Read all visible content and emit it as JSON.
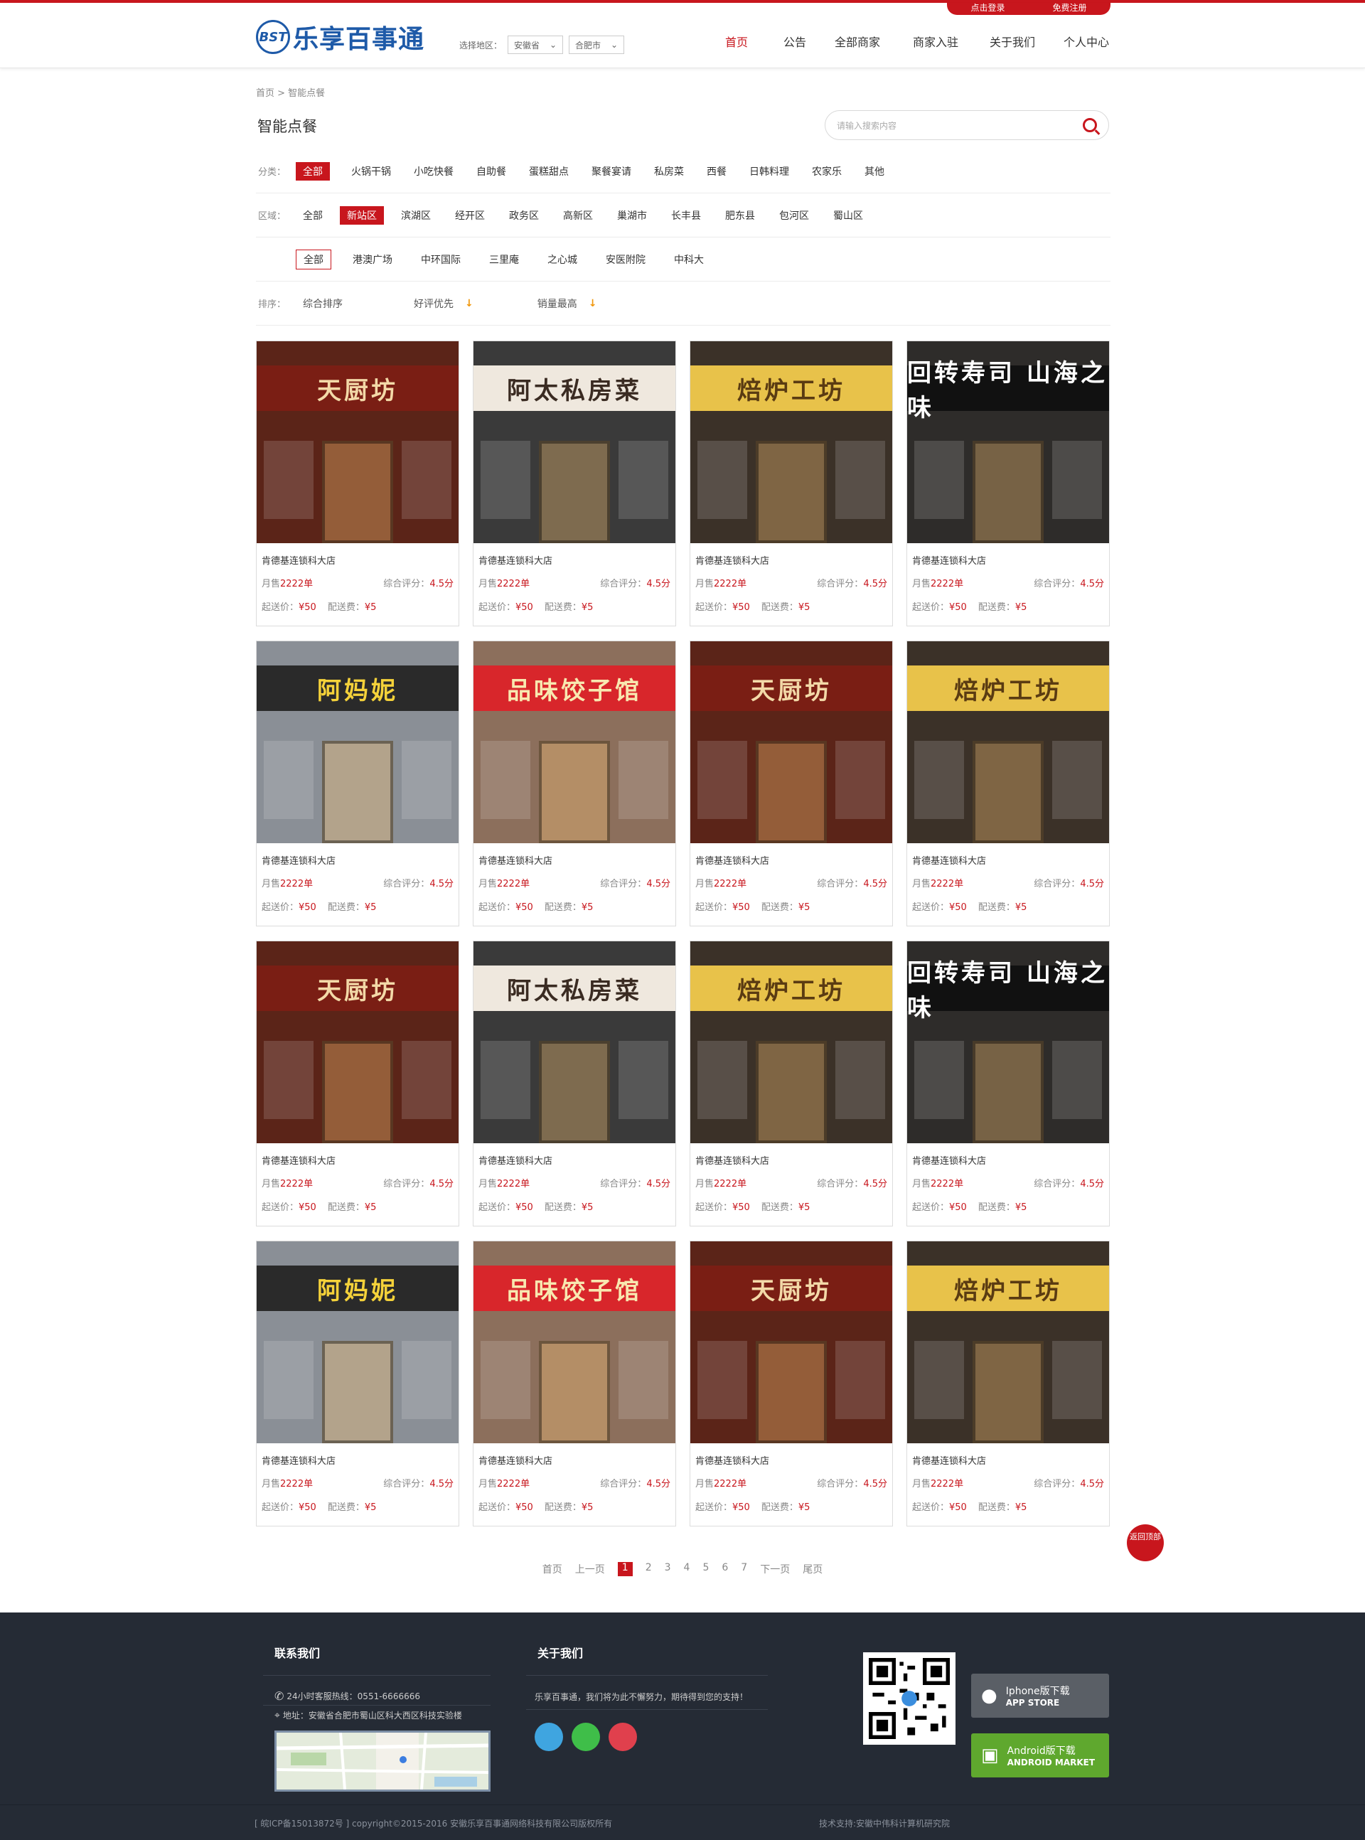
{
  "top_links": {
    "login": "点击登录",
    "register": "免费注册"
  },
  "logo": {
    "badge": "BST",
    "name": "乐享百事通"
  },
  "region": {
    "label": "选择地区：",
    "province": "安徽省",
    "city": "合肥市"
  },
  "nav": [
    "首页",
    "公告",
    "全部商家",
    "商家入驻",
    "关于我们",
    "个人中心"
  ],
  "breadcrumb": "首页 > 智能点餐",
  "page_title": "智能点餐",
  "search": {
    "placeholder": "请输入搜索内容"
  },
  "filters": {
    "category_label": "分类：",
    "categories": [
      "全部",
      "火锅干锅",
      "小吃快餐",
      "自助餐",
      "蛋糕甜点",
      "聚餐宴请",
      "私房菜",
      "西餐",
      "日韩料理",
      "农家乐",
      "其他"
    ],
    "area_label": "区域：",
    "areas": [
      "全部",
      "新站区",
      "滨湖区",
      "经开区",
      "政务区",
      "高新区",
      "巢湖市",
      "长丰县",
      "肥东县",
      "包河区",
      "蜀山区"
    ],
    "subareas": [
      "全部",
      "港澳广场",
      "中环国际",
      "三里庵",
      "之心城",
      "安医附院",
      "中科大"
    ],
    "sort_label": "排序：",
    "sorts": [
      "综合排序",
      "好评优先",
      "销量最高"
    ]
  },
  "cards": [
    {
      "name": "肯德基连锁科大店",
      "sales": "2222单",
      "score": "4.5分",
      "min": "¥50",
      "fee": "¥5",
      "sign": "天厨坊",
      "theme": "red"
    },
    {
      "name": "肯德基连锁科大店",
      "sales": "2222单",
      "score": "4.5分",
      "min": "¥50",
      "fee": "¥5",
      "sign": "阿太私房菜",
      "theme": "dark"
    },
    {
      "name": "肯德基连锁科大店",
      "sales": "2222单",
      "score": "4.5分",
      "min": "¥50",
      "fee": "¥5",
      "sign": "焙炉工坊",
      "theme": "gold"
    },
    {
      "name": "肯德基连锁科大店",
      "sales": "2222单",
      "score": "4.5分",
      "min": "¥50",
      "fee": "¥5",
      "sign": "回转寿司 山海之味",
      "theme": "black"
    },
    {
      "name": "肯德基连锁科大店",
      "sales": "2222单",
      "score": "4.5分",
      "min": "¥50",
      "fee": "¥5",
      "sign": "阿妈妮",
      "theme": "yellow"
    },
    {
      "name": "肯德基连锁科大店",
      "sales": "2222单",
      "score": "4.5分",
      "min": "¥50",
      "fee": "¥5",
      "sign": "品味饺子馆",
      "theme": "white"
    },
    {
      "name": "肯德基连锁科大店",
      "sales": "2222单",
      "score": "4.5分",
      "min": "¥50",
      "fee": "¥5",
      "sign": "天厨坊",
      "theme": "red"
    },
    {
      "name": "肯德基连锁科大店",
      "sales": "2222单",
      "score": "4.5分",
      "min": "¥50",
      "fee": "¥5",
      "sign": "焙炉工坊",
      "theme": "gold"
    },
    {
      "name": "肯德基连锁科大店",
      "sales": "2222单",
      "score": "4.5分",
      "min": "¥50",
      "fee": "¥5",
      "sign": "天厨坊",
      "theme": "red"
    },
    {
      "name": "肯德基连锁科大店",
      "sales": "2222单",
      "score": "4.5分",
      "min": "¥50",
      "fee": "¥5",
      "sign": "阿太私房菜",
      "theme": "dark"
    },
    {
      "name": "肯德基连锁科大店",
      "sales": "2222单",
      "score": "4.5分",
      "min": "¥50",
      "fee": "¥5",
      "sign": "焙炉工坊",
      "theme": "gold"
    },
    {
      "name": "肯德基连锁科大店",
      "sales": "2222单",
      "score": "4.5分",
      "min": "¥50",
      "fee": "¥5",
      "sign": "回转寿司 山海之味",
      "theme": "black"
    },
    {
      "name": "肯德基连锁科大店",
      "sales": "2222单",
      "score": "4.5分",
      "min": "¥50",
      "fee": "¥5",
      "sign": "阿妈妮",
      "theme": "yellow"
    },
    {
      "name": "肯德基连锁科大店",
      "sales": "2222单",
      "score": "4.5分",
      "min": "¥50",
      "fee": "¥5",
      "sign": "品味饺子馆",
      "theme": "white"
    },
    {
      "name": "肯德基连锁科大店",
      "sales": "2222单",
      "score": "4.5分",
      "min": "¥50",
      "fee": "¥5",
      "sign": "天厨坊",
      "theme": "red"
    },
    {
      "name": "肯德基连锁科大店",
      "sales": "2222单",
      "score": "4.5分",
      "min": "¥50",
      "fee": "¥5",
      "sign": "焙炉工坊",
      "theme": "gold"
    }
  ],
  "card_labels": {
    "sales": "月售",
    "score": "综合评分：",
    "min": "起送价：",
    "fee": "配送费："
  },
  "pager": {
    "first": "首页",
    "prev": "上一页",
    "pages": [
      "1",
      "2",
      "3",
      "4",
      "5",
      "6",
      "7"
    ],
    "current": "1",
    "next": "下一页",
    "last": "尾页"
  },
  "backtop": "返回顶部",
  "footer": {
    "contact_title": "联系我们",
    "hotline": "24小时客服热线：0551-6666666",
    "address": "地址：安徽省合肥市蜀山区科大西区科技实验楼",
    "about_title": "关于我们",
    "about_text": "乐享百事通，我们将为此不懈努力，期待得到您的支持！",
    "ios_line1": "Iphone版下载",
    "ios_line2": "APP STORE",
    "android_line1": "Android版下载",
    "android_line2": "ANDROID MARKET",
    "copyright": "[ 皖ICP备15013872号 ] copyright©2015-2016  安徽乐享百事通网络科技有限公司版权所有",
    "tech": "技术支持:安徽中伟科计算机研究院"
  },
  "colors": {
    "brand_red": "#c8161d",
    "brand_blue": "#1e5aa8",
    "footer_bg": "#252b35",
    "ios_btn": "#5a5f66",
    "android_btn": "#5fa82e"
  }
}
